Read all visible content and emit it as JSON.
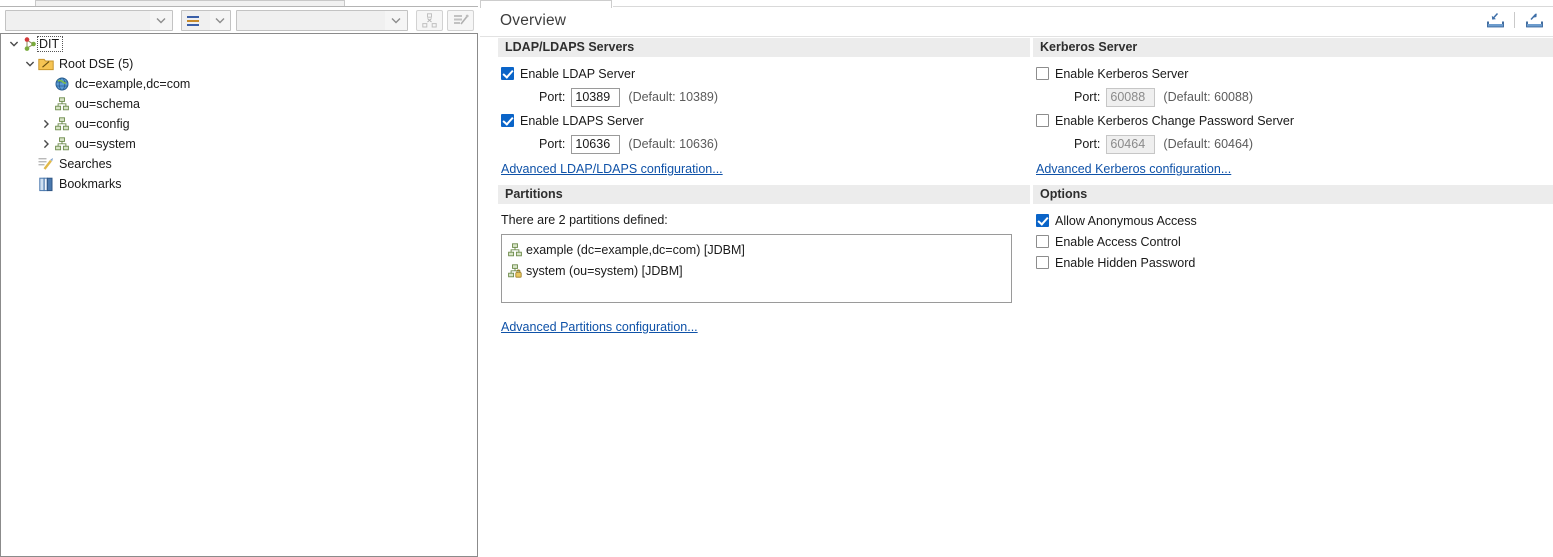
{
  "left_toolbar": {
    "attribute_combo_value": "",
    "attribute_combo_placeholder": "",
    "operator_combo_value": "=",
    "value_combo_value": "",
    "value_combo_placeholder": "",
    "tree_button_icon": "collapse-tree-icon",
    "clear_button_icon": "clear-filter-icon"
  },
  "tree": {
    "items": [
      {
        "label": "DIT",
        "icon": "dit-tree-icon",
        "depth": 0,
        "twisty": "down",
        "selected": true
      },
      {
        "label": "Root DSE (5)",
        "icon": "root-dse-icon",
        "depth": 1,
        "twisty": "down",
        "selected": false
      },
      {
        "label": "dc=example,dc=com",
        "icon": "globe-entry-icon",
        "depth": 2,
        "twisty": "none",
        "selected": false
      },
      {
        "label": "ou=schema",
        "icon": "org-unit-icon",
        "depth": 2,
        "twisty": "none",
        "selected": false
      },
      {
        "label": "ou=config",
        "icon": "org-unit-icon",
        "depth": 2,
        "twisty": "right",
        "selected": false
      },
      {
        "label": "ou=system",
        "icon": "org-unit-icon",
        "depth": 2,
        "twisty": "right",
        "selected": false
      },
      {
        "label": "Searches",
        "icon": "searches-icon",
        "depth": 1,
        "twisty": "none",
        "selected": false
      },
      {
        "label": "Bookmarks",
        "icon": "bookmarks-icon",
        "depth": 1,
        "twisty": "none",
        "selected": false
      }
    ]
  },
  "editor": {
    "tab_label": "Overview",
    "title": "Overview",
    "import_action_label": "import-icon",
    "export_action_label": "export-icon"
  },
  "ldap_section": {
    "title": "LDAP/LDAPS Servers",
    "enable_ldap_label": "Enable LDAP Server",
    "enable_ldap_checked": true,
    "ldap_port_label": "Port:",
    "ldap_port_value": "10389",
    "ldap_port_default": "(Default: 10389)",
    "enable_ldaps_label": "Enable LDAPS Server",
    "enable_ldaps_checked": true,
    "ldaps_port_label": "Port:",
    "ldaps_port_value": "10636",
    "ldaps_port_default": "(Default: 10636)",
    "advanced_link": "Advanced LDAP/LDAPS configuration..."
  },
  "kerberos_section": {
    "title": "Kerberos Server",
    "enable_kerberos_label": "Enable Kerberos Server",
    "enable_kerberos_checked": false,
    "kerberos_port_label": "Port:",
    "kerberos_port_value": "60088",
    "kerberos_port_default": "(Default: 60088)",
    "enable_changepw_label": "Enable Kerberos Change Password Server",
    "enable_changepw_checked": false,
    "changepw_port_label": "Port:",
    "changepw_port_value": "60464",
    "changepw_port_default": "(Default: 60464)",
    "advanced_link": "Advanced Kerberos configuration..."
  },
  "partitions_section": {
    "title": "Partitions",
    "summary": "There are 2 partitions defined:",
    "items": [
      {
        "label": "example (dc=example,dc=com) [JDBM]",
        "icon": "partition-icon"
      },
      {
        "label": "system (ou=system) [JDBM]",
        "icon": "partition-locked-icon"
      }
    ],
    "advanced_link": "Advanced Partitions configuration..."
  },
  "options_section": {
    "title": "Options",
    "items": [
      {
        "label": "Allow Anonymous Access",
        "checked": true
      },
      {
        "label": "Enable Access Control",
        "checked": false
      },
      {
        "label": "Enable Hidden Password",
        "checked": false
      }
    ]
  },
  "colors": {
    "checkbox_on": "#0a64c8",
    "link": "#0f52a8",
    "section_header_bg": "#ececec",
    "pane_border": "#8b8b8b"
  }
}
